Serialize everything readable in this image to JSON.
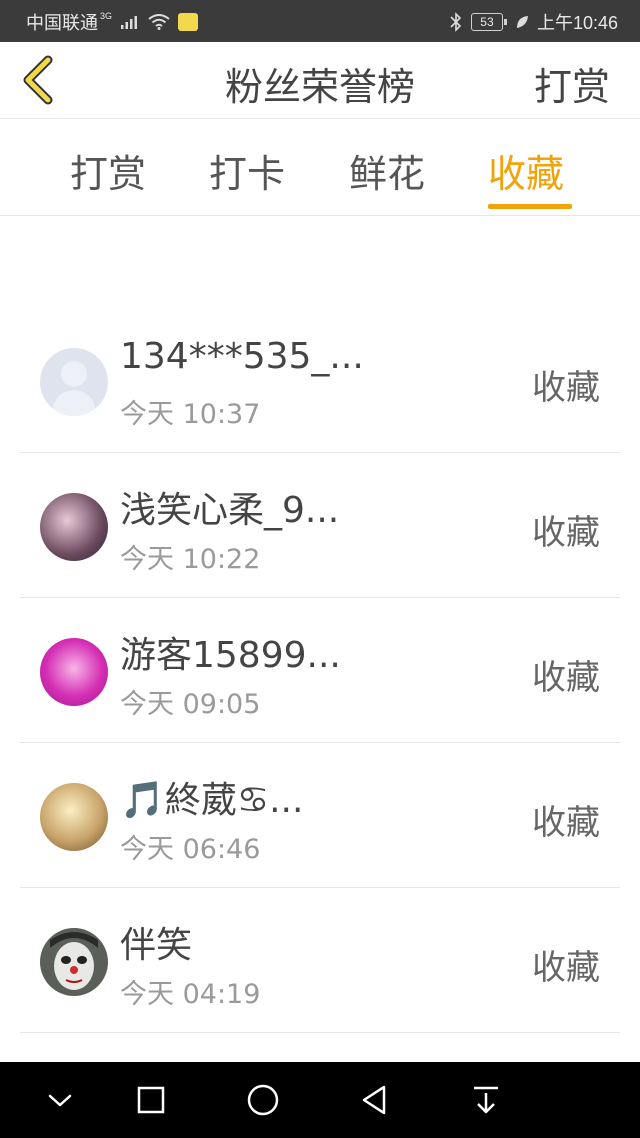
{
  "status_bar": {
    "carrier": "中国联通",
    "network": "3G",
    "battery": "53",
    "time": "上午10:46"
  },
  "header": {
    "title": "粉丝荣誉榜",
    "action_label": "打赏"
  },
  "tabs": [
    {
      "label": "打赏",
      "active": false
    },
    {
      "label": "打卡",
      "active": false
    },
    {
      "label": "鲜花",
      "active": false
    },
    {
      "label": "收藏",
      "active": true
    }
  ],
  "list": [
    {
      "name": "134***535_...",
      "time": "今天 10:37",
      "action": "收藏"
    },
    {
      "name": "浅笑心柔_9...",
      "time": "今天 10:22",
      "action": "收藏"
    },
    {
      "name": "游客15899...",
      "time": "今天 09:05",
      "action": "收藏"
    },
    {
      "name": "🎵終葳♋...",
      "time": "今天 06:46",
      "action": "收藏"
    },
    {
      "name": "伴笑",
      "time": "今天 04:19",
      "action": "收藏"
    }
  ],
  "colors": {
    "accent": "#f0a40a",
    "status_bar": "#3b3b3b",
    "nav_bar": "#000000"
  },
  "icons": {
    "back": "chevron-left-icon",
    "nav": [
      "chevron-down-icon",
      "square-icon",
      "circle-icon",
      "triangle-back-icon",
      "download-icon"
    ]
  }
}
